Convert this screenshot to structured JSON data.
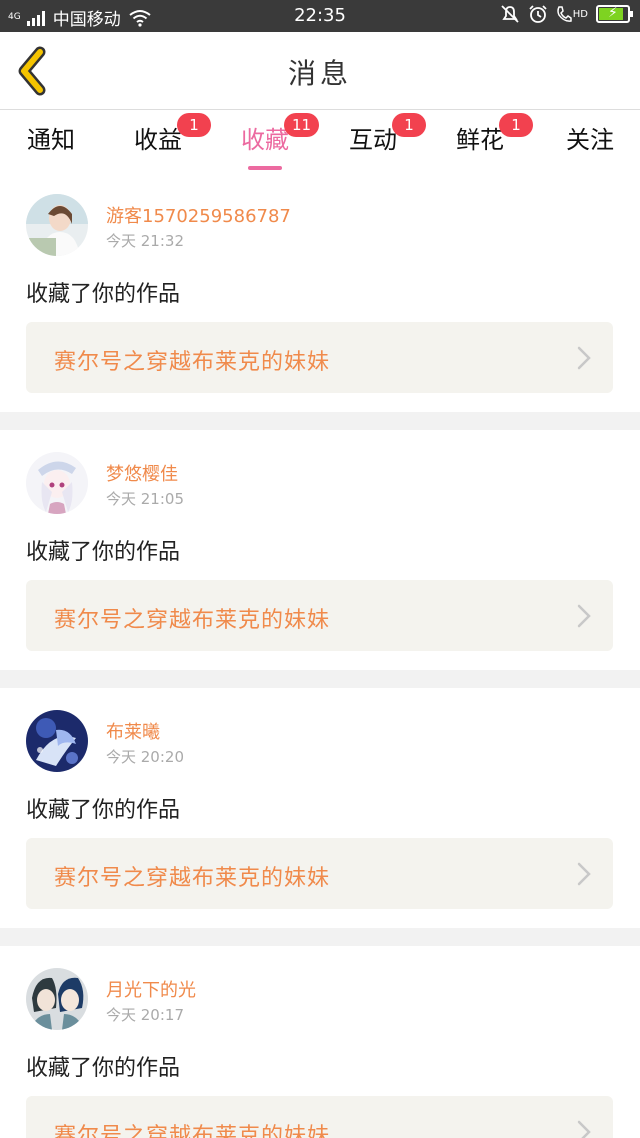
{
  "status_bar": {
    "network": "4G",
    "carrier": "中国移动",
    "time": "22:35",
    "hd_label": "HD",
    "battery_level": 0.8,
    "icons": [
      "signal-icon",
      "wifi-icon",
      "mute-icon",
      "alarm-icon",
      "hd-call-icon",
      "battery-icon"
    ]
  },
  "header": {
    "title": "消息",
    "back_icon": "chevron-left-icon"
  },
  "tabs": [
    {
      "label": "通知",
      "badge": "",
      "active": false
    },
    {
      "label": "收益",
      "badge": "1",
      "active": false
    },
    {
      "label": "收藏",
      "badge": "11",
      "active": true
    },
    {
      "label": "互动",
      "badge": "1",
      "active": false
    },
    {
      "label": "鲜花",
      "badge": "1",
      "active": false
    },
    {
      "label": "关注",
      "badge": "",
      "active": false
    }
  ],
  "messages": [
    {
      "user": "游客15702595867​87",
      "time": "今天 21:32",
      "action": "收藏了你的作品",
      "work": "赛尔号之穿越布莱克的妹妹"
    },
    {
      "user": "梦悠樱佳",
      "time": "今天 21:05",
      "action": "收藏了你的作品",
      "work": "赛尔号之穿越布莱克的妹妹"
    },
    {
      "user": "布莱曦",
      "time": "今天 20:20",
      "action": "收藏了你的作品",
      "work": "赛尔号之穿越布莱克的妹妹"
    },
    {
      "user": "月光下的光",
      "time": "今天 20:17",
      "action": "收藏了你的作品",
      "work": "赛尔号之穿越布莱克的妹妹"
    }
  ],
  "colors": {
    "accent_pink": "#ec6aa0",
    "badge_red": "#f2414f",
    "name_orange": "#f08a4b",
    "back_yellow": "#f5c400"
  }
}
